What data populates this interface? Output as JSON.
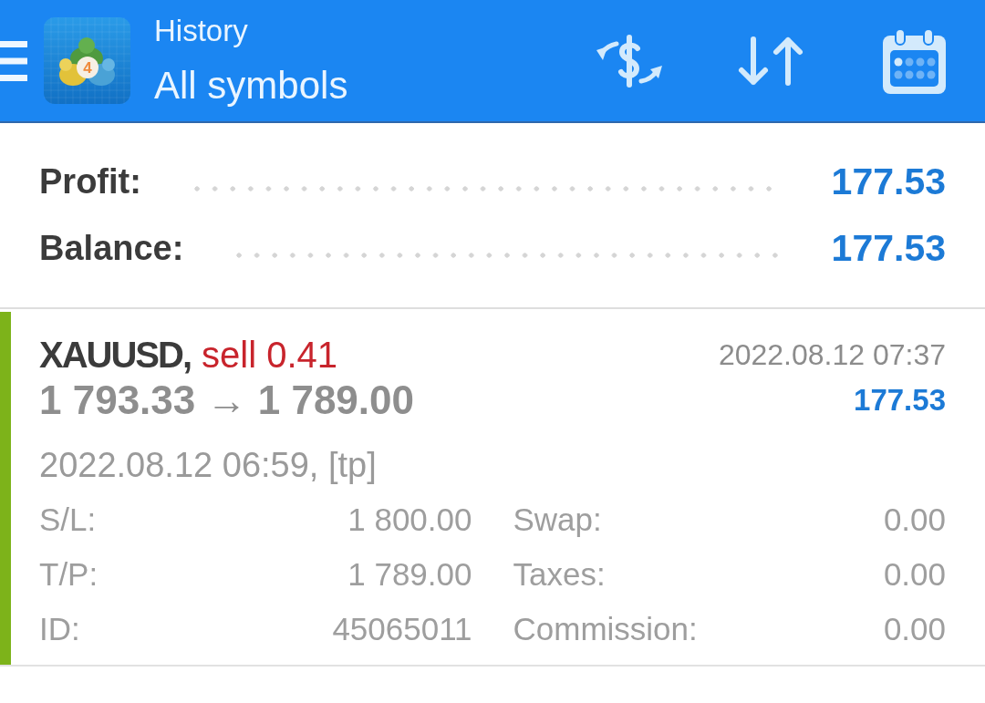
{
  "toolbar": {
    "logo_badge": "4",
    "title": "History",
    "subtitle": "All symbols"
  },
  "summary": [
    {
      "label": "Profit:",
      "value": "177.53"
    },
    {
      "label": "Balance:",
      "value": "177.53"
    }
  ],
  "deals": [
    {
      "color": "#7db31a",
      "symbol": "XAUUSD,",
      "kind": "sell",
      "order": "sell 0.41",
      "time": "2022.08.12 07:37",
      "prices": "**1 793.33** → **1 789.00**",
      "profit": "177.53",
      "open_info": "2022.08.12 06:59, [tp]",
      "fields": [
        {
          "label": "S/L:",
          "value": "1 800.00"
        },
        {
          "label": "Swap:",
          "value": "0.00"
        },
        {
          "label": "T/P:",
          "value": "1 789.00"
        },
        {
          "label": "Taxes:",
          "value": "0.00"
        },
        {
          "label": "ID:",
          "value": "45065011"
        },
        {
          "label": "Commission:",
          "value": "0.00"
        }
      ]
    }
  ]
}
